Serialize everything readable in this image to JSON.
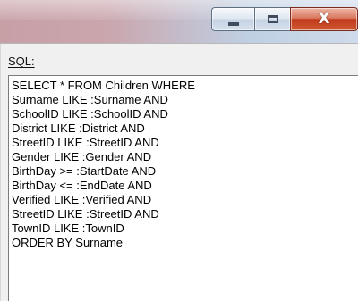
{
  "window": {
    "title": "",
    "buttons": {
      "minimize_icon": "minimize-icon",
      "maximize_icon": "maximize-icon",
      "close_icon": "close-icon",
      "close_glyph": "X"
    }
  },
  "sql": {
    "label": "SQL:",
    "lines": [
      "SELECT * FROM Children WHERE",
      "Surname LIKE :Surname AND",
      "SchoolID LIKE :SchoolID AND",
      "District LIKE :District AND",
      "StreetID LIKE :StreetID AND",
      "Gender LIKE :Gender AND",
      "BirthDay >= :StartDate AND",
      "BirthDay <= :EndDate AND",
      "Verified LIKE :Verified AND",
      "StreetID LIKE :StreetID AND",
      "TownID LIKE :TownID",
      "ORDER BY Surname"
    ]
  },
  "colors": {
    "title_left": "#c7a0a6",
    "title_right": "#cfdaea",
    "close_button": "#c1391b",
    "window_bg": "#f0f0f0",
    "editor_bg": "#ffffff"
  }
}
